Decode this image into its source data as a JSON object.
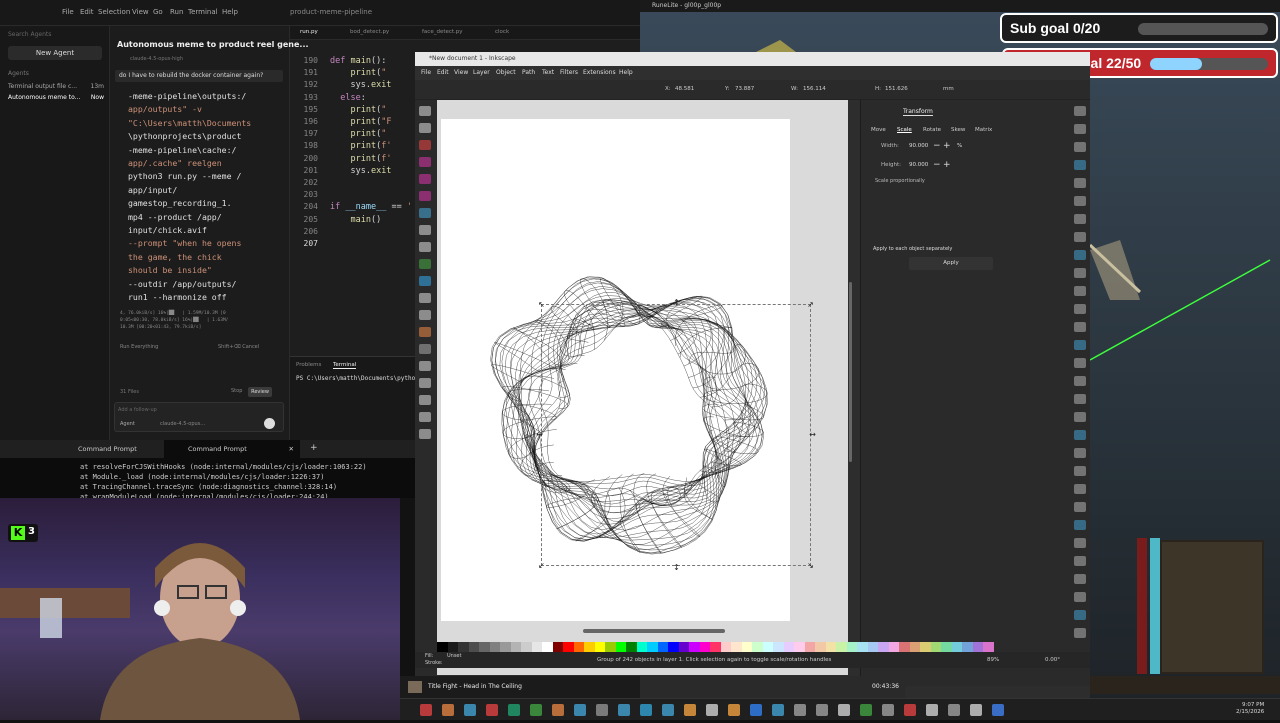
{
  "editor": {
    "menus": [
      "File",
      "Edit",
      "Selection",
      "View",
      "Go",
      "Run",
      "Terminal",
      "Help"
    ],
    "window_title": "product-meme-pipeline",
    "search_placeholder": "Search Agents",
    "new_agent": "New Agent",
    "agents_header": "Agents",
    "agents": [
      {
        "label": "Terminal output file c...",
        "time": "13m"
      },
      {
        "label": "Autonomous meme to...",
        "time": "Now"
      }
    ],
    "chat": {
      "title": "Autonomous meme to product reel gene...",
      "model": "claude-4.5-opus-high",
      "question": "do I have to rebuild the docker container again?",
      "command_lines": [
        "-meme-pipeline\\outputs:/",
        "app/outputs\" -v",
        "\"C:\\Users\\matth\\Documents",
        "\\pythonprojects\\product",
        "-meme-pipeline\\cache:/",
        "app/.cache\" reelgen",
        "python3 run.py --meme /",
        "app/input/",
        "gamestop_recording_1.",
        "mp4 --product /app/",
        "input/chick.avif",
        "--prompt \"when he opens",
        "the game, the chick",
        "should be inside\"",
        "--outdir /app/outputs/",
        "run1 --harmonize off"
      ],
      "stats": "4, 76.0kiB/s] 16%|██   | 1.59M/10.3M [0\n0:05<00:30, 78.0kiB/s] 16%|██   | 1.63M/\n10.3M [00:20<01:43, 79.7kiB/s]",
      "run_everything": "Run Everything",
      "run_cancel": "Shift+⌫ Cancel",
      "files": "31 Files",
      "stop": "Stop",
      "review": "Review",
      "followup_placeholder": "Add a follow-up",
      "agent_mode": "Agent",
      "agent_model": "claude-4.5-opus..."
    },
    "code_tabs": [
      "run.py",
      "bod_detect.py",
      "face_detect.py",
      "clock"
    ],
    "code_lines": [
      {
        "n": "190",
        "html": "<span class='kw'>def</span> <span class='fn'>main</span>():"
      },
      {
        "n": "191",
        "html": "    <span class='fn'>print</span>(<span class='st'>\"</span>"
      },
      {
        "n": "192",
        "html": "    sys.<span class='fn'>exit</span>"
      },
      {
        "n": "193",
        "html": "  <span class='kw'>else</span>:"
      },
      {
        "n": "195",
        "html": "    <span class='fn'>print</span>(<span class='st'>\"</span>"
      },
      {
        "n": "196",
        "html": "    <span class='fn'>print</span>(<span class='st'>\"F</span>"
      },
      {
        "n": "197",
        "html": "    <span class='fn'>print</span>(<span class='st'>\"</span>"
      },
      {
        "n": "198",
        "html": "    <span class='fn'>print</span>(<span class='st'>f'</span>"
      },
      {
        "n": "200",
        "html": "    <span class='fn'>print</span>(<span class='st'>f'</span>"
      },
      {
        "n": "201",
        "html": "    sys.<span class='fn'>exit</span>"
      },
      {
        "n": "202",
        "html": ""
      },
      {
        "n": "203",
        "html": ""
      },
      {
        "n": "204",
        "html": "<span class='kw'>if</span> <span class='vr'>__name__</span> == <span class='st'>'</span>"
      },
      {
        "n": "205",
        "html": "    <span class='fn'>main</span>()"
      },
      {
        "n": "206",
        "html": ""
      },
      {
        "n": "207",
        "html": ""
      }
    ],
    "terminal_tabs": {
      "problems": "Problems",
      "terminal": "Terminal"
    },
    "terminal_line": "PS C:\\Users\\matth\\Documents\\python"
  },
  "cmd": {
    "tabs": [
      "Command Prompt",
      "Command Prompt"
    ],
    "output": "at resolveForCJSWithHooks (node:internal/modules/cjs/loader:1063:22)\nat Module._load (node:internal/modules/cjs/loader:1226:37)\nat TracingChannel.traceSync (node:diagnostics_channel:328:14)\nat wrapModuleLoad (node:internal/modules/cjs/loader:244:24)"
  },
  "webcam": {
    "badge_count": "3"
  },
  "inkscape": {
    "title": "*New document 1 - Inkscape",
    "menus": [
      "File",
      "Edit",
      "View",
      "Layer",
      "Object",
      "Path",
      "Text",
      "Filters",
      "Extensions",
      "Help"
    ],
    "toolbar": {
      "x_label": "X:",
      "x": "48.581",
      "y_label": "Y:",
      "y": "73.887",
      "w_label": "W:",
      "w": "156.114",
      "h_label": "H:",
      "h": "151.626",
      "unit": "mm"
    },
    "panel": {
      "tab": "Transform",
      "tabs": [
        "Move",
        "Scale",
        "Rotate",
        "Skew",
        "Matrix"
      ],
      "width_label": "Width:",
      "width": "90.000",
      "height_label": "Height:",
      "height": "90.000",
      "unit": "%",
      "scale_prop": "Scale proportionally",
      "apply_each": "Apply to each object separately",
      "apply": "Apply"
    },
    "status": {
      "fill": "Fill:",
      "stroke": "Stroke:",
      "unset": "Unset",
      "message": "Group of 242 objects in layer 1. Click selection again to toggle scale/rotation handles",
      "zoom": "89%",
      "rotation": "0.00°"
    },
    "palette": [
      "#000000",
      "#1a1a1a",
      "#333333",
      "#4d4d4d",
      "#666666",
      "#808080",
      "#999999",
      "#b3b3b3",
      "#cccccc",
      "#e6e6e6",
      "#ffffff",
      "#800000",
      "#ff0000",
      "#ff6600",
      "#ffcc00",
      "#ffff00",
      "#99cc00",
      "#00ff00",
      "#008000",
      "#00ffcc",
      "#00ccff",
      "#0066ff",
      "#0000ff",
      "#6600cc",
      "#cc00ff",
      "#ff00cc",
      "#ff3366",
      "#ffcccc",
      "#ffe6cc",
      "#ffffcc",
      "#ccffcc",
      "#ccffff",
      "#cce6ff",
      "#e6ccff",
      "#ffccee",
      "#f2a6a6",
      "#f2c8a6",
      "#f2e2a6",
      "#c8f2a6",
      "#a6f2c8",
      "#a6e2f2",
      "#a6c8f2",
      "#c8a6f2",
      "#f2a6e2",
      "#d97373",
      "#d9a173",
      "#d9cc73",
      "#a1d973",
      "#73d9a1",
      "#73ccd9",
      "#73a1d9",
      "#a173d9",
      "#d973cc"
    ]
  },
  "stream": {
    "game_title": "RuneLite - gl00p_gl00p",
    "sub_goal": "Sub goal 0/20",
    "sub_goal_progress": 0.0,
    "follower_goal": "Follower goal 22/50",
    "follower_goal_progress": 0.44
  },
  "media": {
    "text": "Title Fight - Head in The Ceiling",
    "hud_time": "00:43:36"
  },
  "clock": {
    "time": "9:07 PM",
    "date": "2/15/2026"
  }
}
